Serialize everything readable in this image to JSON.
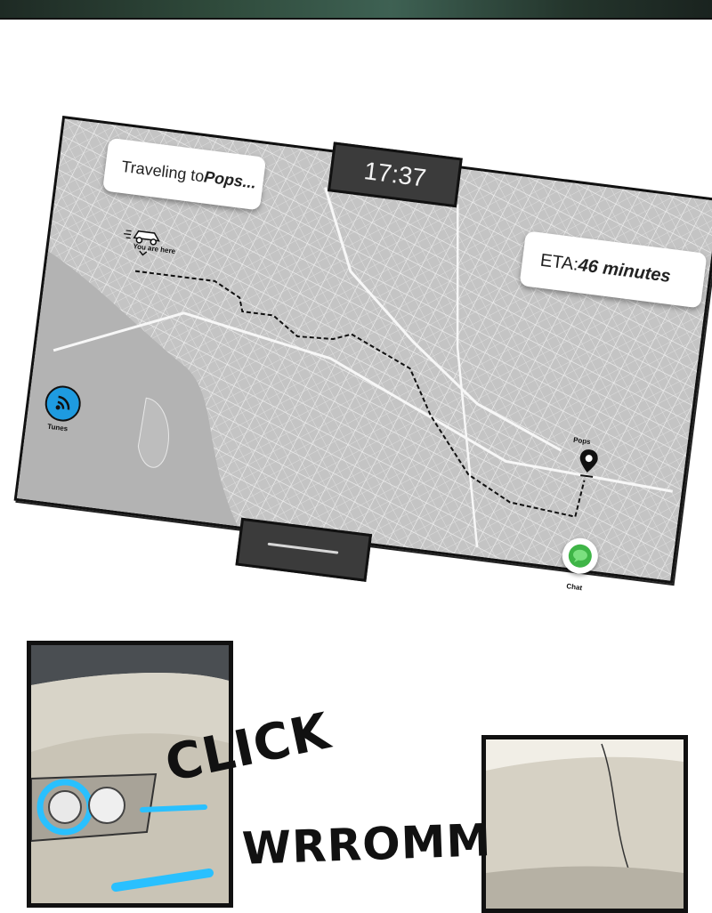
{
  "screen": {
    "clock": "17:37",
    "traveling_prefix": "Traveling to ",
    "traveling_dest": "Pops...",
    "eta_prefix": "ETA: ",
    "eta_value": "46 minutes",
    "you_are_here": "You are here",
    "destination_label": "Pops",
    "apps": [
      {
        "label": "Tunes",
        "icon": "wifi-icon",
        "color": "#1e9be0"
      },
      {
        "label": "Chat",
        "icon": "chat-bubble-icon",
        "color": "#3fb547"
      }
    ],
    "map_color": "#c9c9c9"
  },
  "comic": {
    "sfx_click": "CLICK",
    "sfx_wrromm": "WRROMM",
    "headlight_color": "#29c0ff"
  }
}
